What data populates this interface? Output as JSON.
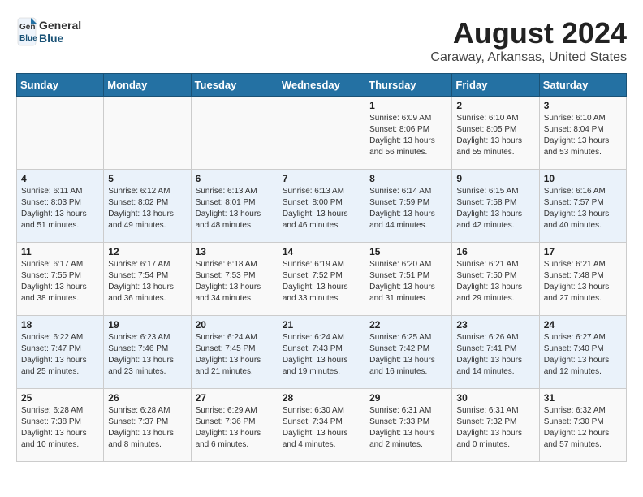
{
  "header": {
    "logo": {
      "general": "General",
      "blue": "Blue"
    },
    "title": "August 2024",
    "subtitle": "Caraway, Arkansas, United States"
  },
  "weekdays": [
    "Sunday",
    "Monday",
    "Tuesday",
    "Wednesday",
    "Thursday",
    "Friday",
    "Saturday"
  ],
  "weeks": [
    [
      {
        "day": "",
        "info": ""
      },
      {
        "day": "",
        "info": ""
      },
      {
        "day": "",
        "info": ""
      },
      {
        "day": "",
        "info": ""
      },
      {
        "day": "1",
        "info": "Sunrise: 6:09 AM\nSunset: 8:06 PM\nDaylight: 13 hours\nand 56 minutes."
      },
      {
        "day": "2",
        "info": "Sunrise: 6:10 AM\nSunset: 8:05 PM\nDaylight: 13 hours\nand 55 minutes."
      },
      {
        "day": "3",
        "info": "Sunrise: 6:10 AM\nSunset: 8:04 PM\nDaylight: 13 hours\nand 53 minutes."
      }
    ],
    [
      {
        "day": "4",
        "info": "Sunrise: 6:11 AM\nSunset: 8:03 PM\nDaylight: 13 hours\nand 51 minutes."
      },
      {
        "day": "5",
        "info": "Sunrise: 6:12 AM\nSunset: 8:02 PM\nDaylight: 13 hours\nand 49 minutes."
      },
      {
        "day": "6",
        "info": "Sunrise: 6:13 AM\nSunset: 8:01 PM\nDaylight: 13 hours\nand 48 minutes."
      },
      {
        "day": "7",
        "info": "Sunrise: 6:13 AM\nSunset: 8:00 PM\nDaylight: 13 hours\nand 46 minutes."
      },
      {
        "day": "8",
        "info": "Sunrise: 6:14 AM\nSunset: 7:59 PM\nDaylight: 13 hours\nand 44 minutes."
      },
      {
        "day": "9",
        "info": "Sunrise: 6:15 AM\nSunset: 7:58 PM\nDaylight: 13 hours\nand 42 minutes."
      },
      {
        "day": "10",
        "info": "Sunrise: 6:16 AM\nSunset: 7:57 PM\nDaylight: 13 hours\nand 40 minutes."
      }
    ],
    [
      {
        "day": "11",
        "info": "Sunrise: 6:17 AM\nSunset: 7:55 PM\nDaylight: 13 hours\nand 38 minutes."
      },
      {
        "day": "12",
        "info": "Sunrise: 6:17 AM\nSunset: 7:54 PM\nDaylight: 13 hours\nand 36 minutes."
      },
      {
        "day": "13",
        "info": "Sunrise: 6:18 AM\nSunset: 7:53 PM\nDaylight: 13 hours\nand 34 minutes."
      },
      {
        "day": "14",
        "info": "Sunrise: 6:19 AM\nSunset: 7:52 PM\nDaylight: 13 hours\nand 33 minutes."
      },
      {
        "day": "15",
        "info": "Sunrise: 6:20 AM\nSunset: 7:51 PM\nDaylight: 13 hours\nand 31 minutes."
      },
      {
        "day": "16",
        "info": "Sunrise: 6:21 AM\nSunset: 7:50 PM\nDaylight: 13 hours\nand 29 minutes."
      },
      {
        "day": "17",
        "info": "Sunrise: 6:21 AM\nSunset: 7:48 PM\nDaylight: 13 hours\nand 27 minutes."
      }
    ],
    [
      {
        "day": "18",
        "info": "Sunrise: 6:22 AM\nSunset: 7:47 PM\nDaylight: 13 hours\nand 25 minutes."
      },
      {
        "day": "19",
        "info": "Sunrise: 6:23 AM\nSunset: 7:46 PM\nDaylight: 13 hours\nand 23 minutes."
      },
      {
        "day": "20",
        "info": "Sunrise: 6:24 AM\nSunset: 7:45 PM\nDaylight: 13 hours\nand 21 minutes."
      },
      {
        "day": "21",
        "info": "Sunrise: 6:24 AM\nSunset: 7:43 PM\nDaylight: 13 hours\nand 19 minutes."
      },
      {
        "day": "22",
        "info": "Sunrise: 6:25 AM\nSunset: 7:42 PM\nDaylight: 13 hours\nand 16 minutes."
      },
      {
        "day": "23",
        "info": "Sunrise: 6:26 AM\nSunset: 7:41 PM\nDaylight: 13 hours\nand 14 minutes."
      },
      {
        "day": "24",
        "info": "Sunrise: 6:27 AM\nSunset: 7:40 PM\nDaylight: 13 hours\nand 12 minutes."
      }
    ],
    [
      {
        "day": "25",
        "info": "Sunrise: 6:28 AM\nSunset: 7:38 PM\nDaylight: 13 hours\nand 10 minutes."
      },
      {
        "day": "26",
        "info": "Sunrise: 6:28 AM\nSunset: 7:37 PM\nDaylight: 13 hours\nand 8 minutes."
      },
      {
        "day": "27",
        "info": "Sunrise: 6:29 AM\nSunset: 7:36 PM\nDaylight: 13 hours\nand 6 minutes."
      },
      {
        "day": "28",
        "info": "Sunrise: 6:30 AM\nSunset: 7:34 PM\nDaylight: 13 hours\nand 4 minutes."
      },
      {
        "day": "29",
        "info": "Sunrise: 6:31 AM\nSunset: 7:33 PM\nDaylight: 13 hours\nand 2 minutes."
      },
      {
        "day": "30",
        "info": "Sunrise: 6:31 AM\nSunset: 7:32 PM\nDaylight: 13 hours\nand 0 minutes."
      },
      {
        "day": "31",
        "info": "Sunrise: 6:32 AM\nSunset: 7:30 PM\nDaylight: 12 hours\nand 57 minutes."
      }
    ]
  ]
}
